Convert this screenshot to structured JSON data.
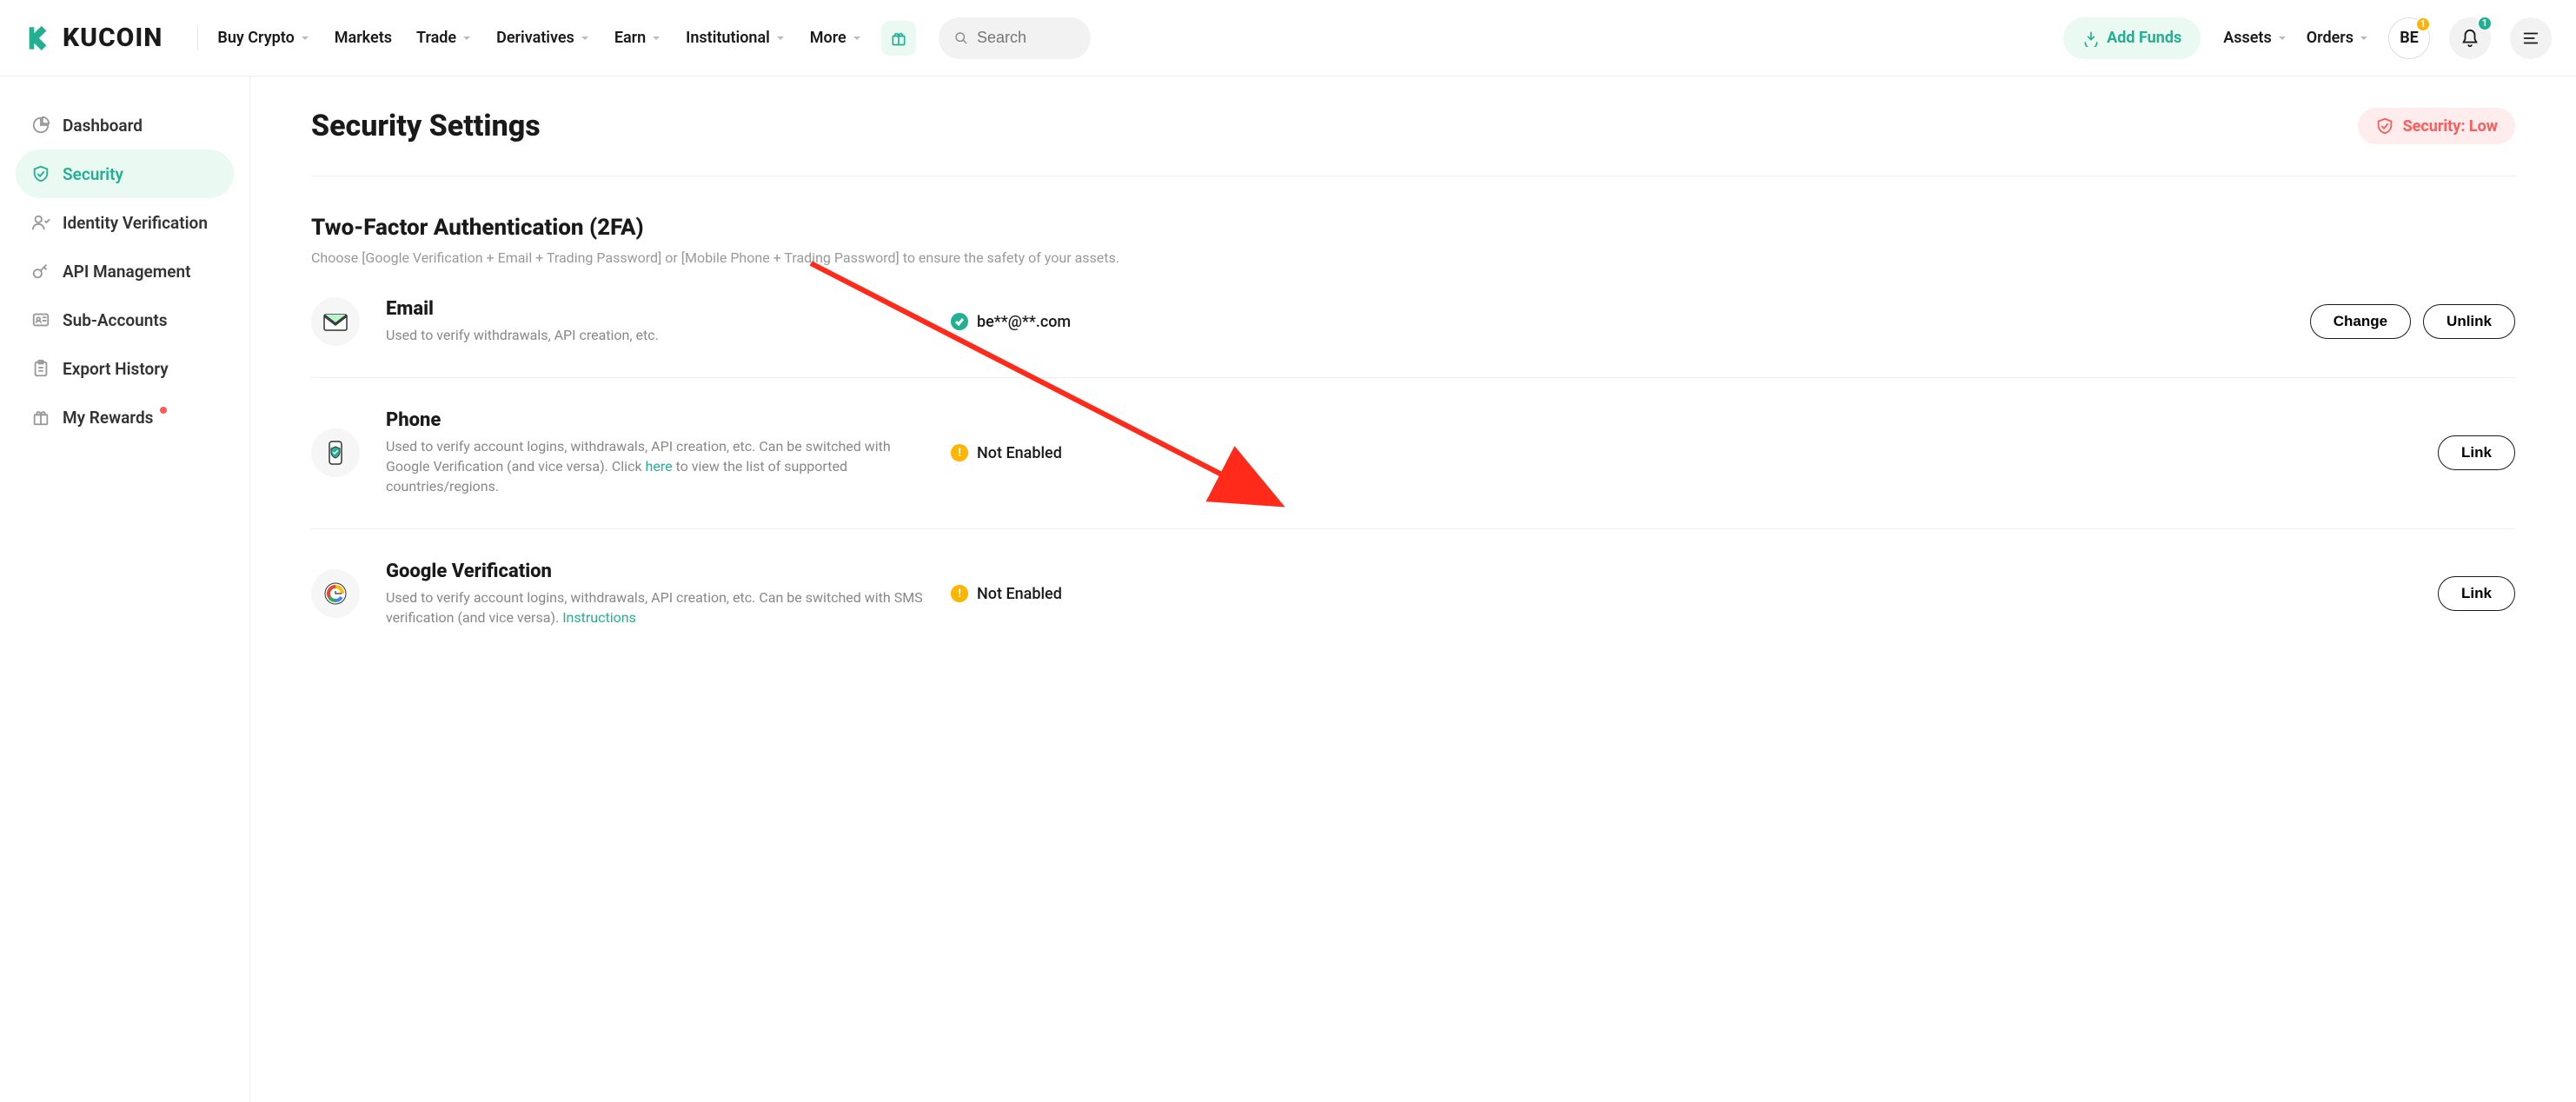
{
  "brand": {
    "name": "KUCOIN"
  },
  "nav": {
    "buy": "Buy Crypto",
    "markets": "Markets",
    "trade": "Trade",
    "derivatives": "Derivatives",
    "earn": "Earn",
    "institutional": "Institutional",
    "more": "More",
    "search_placeholder": "Search",
    "addfunds": "Add Funds",
    "assets": "Assets",
    "orders": "Orders",
    "avatar": "BE",
    "avatar_badge": "1",
    "bell_badge": "1"
  },
  "sidebar": {
    "items": [
      {
        "label": "Dashboard"
      },
      {
        "label": "Security"
      },
      {
        "label": "Identity Verification"
      },
      {
        "label": "API Management"
      },
      {
        "label": "Sub-Accounts"
      },
      {
        "label": "Export History"
      },
      {
        "label": "My Rewards"
      }
    ]
  },
  "page": {
    "title": "Security Settings",
    "security_badge": "Security: Low"
  },
  "tfa": {
    "title": "Two-Factor Authentication (2FA)",
    "subtitle": "Choose [Google Verification + Email + Trading Password] or [Mobile Phone + Trading Password] to ensure the safety of your assets.",
    "email": {
      "title": "Email",
      "desc": "Used to verify withdrawals, API creation, etc.",
      "status": "be**@**.com",
      "btn_change": "Change",
      "btn_unlink": "Unlink"
    },
    "phone": {
      "title": "Phone",
      "desc_before": "Used to verify account logins, withdrawals, API creation, etc. Can be switched with Google Verification (and vice versa). Click ",
      "desc_link": "here",
      "desc_after": " to view the list of supported countries/regions.",
      "status": "Not Enabled",
      "btn_link": "Link"
    },
    "google": {
      "title": "Google Verification",
      "desc_before": "Used to verify account logins, withdrawals, API creation, etc. Can be switched with SMS verification (and vice versa). ",
      "desc_link": "Instructions",
      "status": "Not Enabled",
      "btn_link": "Link"
    }
  }
}
